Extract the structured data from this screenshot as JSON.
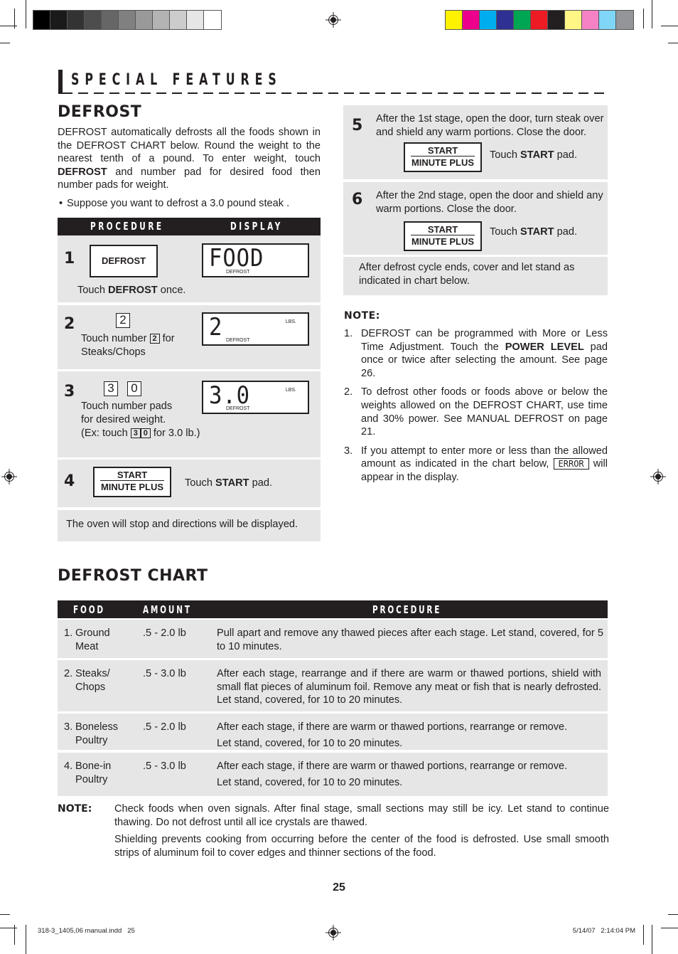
{
  "section_title": "SPECIAL FEATURES",
  "defrost": {
    "heading": "DEFROST",
    "intro_parts": [
      "DEFROST automatically defrosts all the foods shown in the DEFROST CHART below. Round the weight to the nearest tenth of a pound. To enter weight, touch ",
      "DEFROST",
      " and number pad for desired food then number pads for weight."
    ],
    "bullet": "Suppose you want to defrost a 3.0 pound steak ."
  },
  "procedure_table": {
    "header_procedure": "PROCEDURE",
    "header_display": "DISPLAY",
    "steps": [
      {
        "num": "1",
        "pad": "DEFROST",
        "text_pre": "Touch ",
        "text_bold": "DEFROST",
        "text_post": " once.",
        "display": {
          "digits": "FOOD",
          "label": "DEFROST"
        }
      },
      {
        "num": "2",
        "key": "2",
        "text_pre": "Touch number ",
        "inline_key": "2",
        "text_post": " for",
        "text_line2": "Steaks/Chops",
        "display": {
          "digits": "2",
          "label": "DEFROST",
          "unit": "LBS."
        }
      },
      {
        "num": "3",
        "keys": [
          "3",
          "0"
        ],
        "text_line1": "Touch number pads",
        "text_line2": "for desired weight.",
        "text_line3_pre": "(Ex: touch ",
        "inline_keys": [
          "3",
          "0"
        ],
        "text_line3_post": " for 3.0 lb.)",
        "display": {
          "digits": "3.0",
          "label": "DEFROST",
          "unit": "LBS."
        }
      },
      {
        "num": "4",
        "pad_line1": "START",
        "pad_line2": "MINUTE PLUS",
        "text_pre": "Touch ",
        "text_bold": "START",
        "text_post": " pad."
      }
    ],
    "footer": "The oven will stop and directions will be displayed."
  },
  "right_steps": [
    {
      "num": "5",
      "text": "After the 1st stage, open the door, turn steak over and shield any warm portions. Close the door.",
      "pad_line1": "START",
      "pad_line2": "MINUTE PLUS",
      "touch_pre": "Touch ",
      "touch_bold": "START",
      "touch_post": " pad."
    },
    {
      "num": "6",
      "text": "After the 2nd stage, open the door and shield any warm portions. Close the door.",
      "pad_line1": "START",
      "pad_line2": "MINUTE PLUS",
      "touch_pre": "Touch ",
      "touch_bold": "START",
      "touch_post": " pad."
    }
  ],
  "after_cycle": "After defrost cycle ends, cover and let stand as indicated in chart below.",
  "note": {
    "title": "NOTE:",
    "items": [
      {
        "n": "1.",
        "pre": "DEFROST can be programmed with More or Less Time Adjustment. Touch the ",
        "bold": "POWER LEVEL",
        "post": " pad once or twice after selecting the amount. See page 26."
      },
      {
        "n": "2.",
        "text": "To defrost other foods or foods above or below the weights allowed on the DEFROST CHART, use time and 30% power. See MANUAL DEFROST on page 21."
      },
      {
        "n": "3.",
        "pre": "If you attempt to enter more or less than the allowed amount as indicated in the chart below, ",
        "display": "ERROR",
        "post": " will appear in the display."
      }
    ]
  },
  "defrost_chart": {
    "heading": "DEFROST CHART",
    "columns": [
      "FOOD",
      "AMOUNT",
      "PROCEDURE"
    ],
    "rows": [
      {
        "idx": "1.",
        "food1": "Ground",
        "food2": "Meat",
        "amount": ".5 - 2.0 lb",
        "procedure": [
          "Pull apart and remove any thawed pieces after each stage. Let stand, covered, for 5 to 10 minutes."
        ]
      },
      {
        "idx": "2.",
        "food1": "Steaks/",
        "food2": "Chops",
        "amount": ".5 - 3.0 lb",
        "procedure": [
          "After each stage, rearrange and if there are warm or thawed portions, shield with small flat pieces of aluminum foil. Remove any meat or fish that is nearly defrosted. Let stand, covered, for 10 to 20 minutes."
        ]
      },
      {
        "idx": "3.",
        "food1": "Boneless",
        "food2": "Poultry",
        "amount": ".5 - 2.0 lb",
        "procedure": [
          "After each stage, if there are warm or thawed portions, rearrange or remove.",
          "Let stand, covered, for 10 to 20 minutes."
        ]
      },
      {
        "idx": "4.",
        "food1": "Bone-in",
        "food2": "Poultry",
        "amount": ".5 - 3.0 lb",
        "procedure": [
          "After each stage, if there are warm or thawed portions, rearrange or remove.",
          "Let stand, covered, for 10 to 20 minutes."
        ]
      }
    ],
    "note_label": "NOTE:",
    "note_paragraphs": [
      "Check foods when oven signals. After final stage, small sections may still be icy. Let stand to continue thawing. Do not defrost until all ice crystals are thawed.",
      "Shielding prevents cooking from occurring before the center of the food is defrosted. Use small smooth strips of aluminum foil to cover edges and thinner sections of the food."
    ]
  },
  "page_number": "25",
  "slug_left": "318-3_1405,06 manual.indd   25",
  "slug_right": "5/14/07   2:14:04 PM",
  "color_bars": {
    "grayscale": [
      "#000000",
      "#1a1a1a",
      "#333333",
      "#4d4d4d",
      "#666666",
      "#808080",
      "#999999",
      "#b3b3b3",
      "#cccccc",
      "#e6e6e6",
      "#ffffff"
    ],
    "process": [
      "#fff200",
      "#ec008c",
      "#00aeef",
      "#2e3192",
      "#00a651",
      "#ed1c24",
      "#231f20",
      "#fff685",
      "#f482c5",
      "#7fd6f7",
      "#939598"
    ]
  }
}
